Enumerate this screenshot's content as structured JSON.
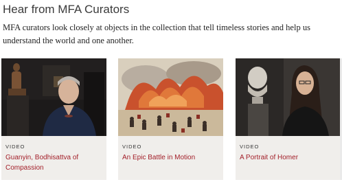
{
  "section": {
    "title": "Hear from MFA Curators",
    "description": "MFA curators look closely at objects in the collection that tell timeless stories and help us understand the world and one another."
  },
  "cards": [
    {
      "kind": "VIDEO",
      "title": "Guanyin, Bodhisattva of Compassion"
    },
    {
      "kind": "VIDEO",
      "title": "An Epic Battle in Motion"
    },
    {
      "kind": "VIDEO",
      "title": "A Portrait of Homer"
    }
  ],
  "colors": {
    "link": "#a3202a",
    "card_bg": "#f0eeeb",
    "title_text": "#3a3a3a"
  }
}
